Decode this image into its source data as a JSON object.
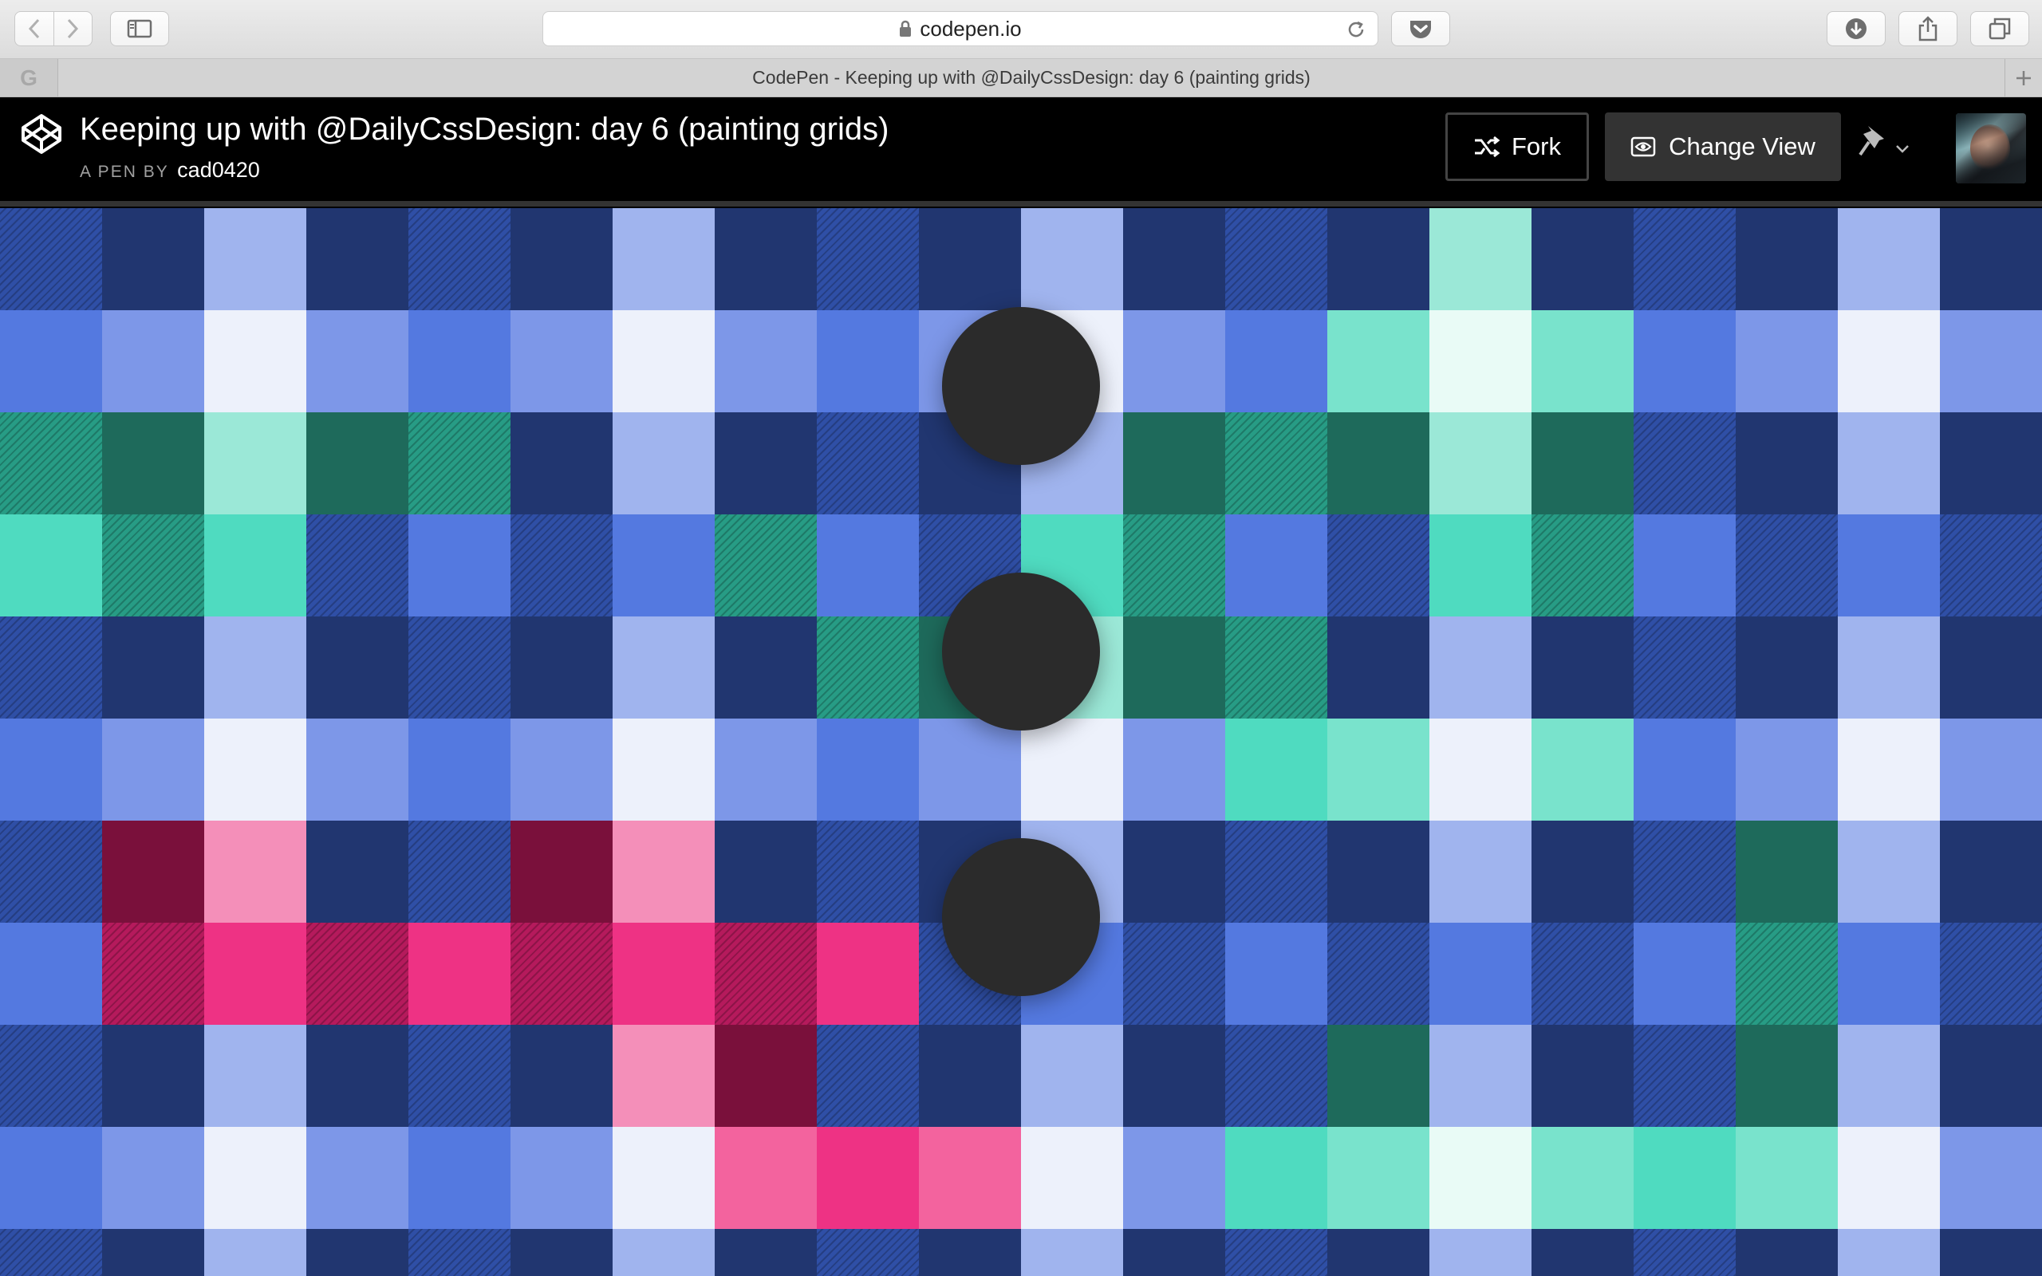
{
  "browser": {
    "url": "codepen.io",
    "tab_title": "CodePen - Keeping up with @DailyCssDesign: day 6 (painting grids)",
    "tab_favicon": "G",
    "icons": [
      "back-icon",
      "forward-icon",
      "sidebar-icon",
      "lock-icon",
      "reload-icon",
      "pocket-icon",
      "download-icon",
      "share-icon",
      "tabs-icon",
      "new-tab-icon"
    ]
  },
  "pen": {
    "title": "Keeping up with @DailyCssDesign: day 6 (painting grids)",
    "by_label": "A PEN BY",
    "author": "cad0420",
    "fork_label": "Fork",
    "change_view_label": "Change View"
  },
  "colors": {
    "navy": "#213670",
    "royal_hatch": "#2f4fa6",
    "periwinkle": "#a0b4ee",
    "blue": "#5479e0",
    "light_blue": "#7d97e8",
    "pale": "#edf1fb",
    "dark_green": "#1e6a5b",
    "green_hatch": "#279c85",
    "mint_light": "#9be8d7",
    "mint": "#4fdbc0",
    "mint_mid": "#79e3cc",
    "mint_pale": "#e9fbf6",
    "maroon": "#7a103b",
    "pink_light": "#f48fb9",
    "magenta": "#ee3284",
    "magenta_hatch": "#b51a5c",
    "pink_mid": "#f3639e",
    "dot": "#2b2b2b"
  },
  "grid": {
    "rows": [
      [
        "h:royal_hatch",
        "navy",
        "periwinkle",
        "navy",
        "h:royal_hatch",
        "navy",
        "periwinkle",
        "navy",
        "h:royal_hatch",
        "navy",
        "periwinkle",
        "navy",
        "h:royal_hatch",
        "navy",
        "mint_light",
        "navy",
        "h:royal_hatch",
        "navy",
        "periwinkle",
        "navy"
      ],
      [
        "blue",
        "light_blue",
        "pale",
        "light_blue",
        "blue",
        "light_blue",
        "pale",
        "light_blue",
        "blue",
        "light_blue",
        "pale",
        "light_blue",
        "blue",
        "mint_mid",
        "mint_pale",
        "mint_mid",
        "blue",
        "light_blue",
        "pale",
        "light_blue"
      ],
      [
        "h:green_hatch",
        "dark_green",
        "mint_light",
        "dark_green",
        "h:green_hatch",
        "navy",
        "periwinkle",
        "navy",
        "h:royal_hatch",
        "navy",
        "periwinkle",
        "dark_green",
        "h:green_hatch",
        "dark_green",
        "mint_light",
        "dark_green",
        "h:royal_hatch",
        "navy",
        "periwinkle",
        "navy"
      ],
      [
        "mint",
        "h:green_hatch",
        "mint",
        "h:royal_hatch",
        "blue",
        "h:royal_hatch",
        "blue",
        "h:green_hatch",
        "blue",
        "h:royal_hatch",
        "mint",
        "h:green_hatch",
        "blue",
        "h:royal_hatch",
        "mint",
        "h:green_hatch",
        "blue",
        "h:royal_hatch",
        "blue",
        "h:royal_hatch"
      ],
      [
        "h:royal_hatch",
        "navy",
        "periwinkle",
        "navy",
        "h:royal_hatch",
        "navy",
        "periwinkle",
        "navy",
        "h:green_hatch",
        "dark_green",
        "mint_light",
        "dark_green",
        "h:green_hatch",
        "navy",
        "periwinkle",
        "navy",
        "h:royal_hatch",
        "navy",
        "periwinkle",
        "navy"
      ],
      [
        "blue",
        "light_blue",
        "pale",
        "light_blue",
        "blue",
        "light_blue",
        "pale",
        "light_blue",
        "blue",
        "light_blue",
        "pale",
        "light_blue",
        "mint",
        "mint_mid",
        "pale",
        "mint_mid",
        "blue",
        "light_blue",
        "pale",
        "light_blue"
      ],
      [
        "h:royal_hatch",
        "maroon",
        "pink_light",
        "navy",
        "h:royal_hatch",
        "maroon",
        "pink_light",
        "navy",
        "h:royal_hatch",
        "navy",
        "periwinkle",
        "navy",
        "h:royal_hatch",
        "navy",
        "periwinkle",
        "navy",
        "h:royal_hatch",
        "dark_green",
        "periwinkle",
        "navy"
      ],
      [
        "blue",
        "h:magenta_hatch",
        "magenta",
        "h:magenta_hatch",
        "magenta",
        "h:magenta_hatch",
        "magenta",
        "h:magenta_hatch",
        "magenta",
        "h:royal_hatch",
        "blue",
        "h:royal_hatch",
        "blue",
        "h:royal_hatch",
        "blue",
        "h:royal_hatch",
        "blue",
        "h:green_hatch",
        "blue",
        "h:royal_hatch"
      ],
      [
        "h:royal_hatch",
        "navy",
        "periwinkle",
        "navy",
        "h:royal_hatch",
        "navy",
        "pink_light",
        "maroon",
        "h:royal_hatch",
        "navy",
        "periwinkle",
        "navy",
        "h:royal_hatch",
        "dark_green",
        "periwinkle",
        "navy",
        "h:royal_hatch",
        "dark_green",
        "periwinkle",
        "navy"
      ],
      [
        "blue",
        "light_blue",
        "pale",
        "light_blue",
        "blue",
        "light_blue",
        "pale",
        "pink_mid",
        "magenta",
        "pink_mid",
        "pale",
        "light_blue",
        "mint",
        "mint_mid",
        "mint_pale",
        "mint_mid",
        "mint",
        "mint_mid",
        "pale",
        "light_blue"
      ],
      [
        "h:royal_hatch",
        "navy",
        "periwinkle",
        "navy",
        "h:royal_hatch",
        "navy",
        "periwinkle",
        "navy",
        "h:royal_hatch",
        "navy",
        "periwinkle",
        "navy",
        "h:royal_hatch",
        "navy",
        "periwinkle",
        "navy",
        "h:royal_hatch",
        "navy",
        "periwinkle",
        "navy"
      ]
    ],
    "dots": 3
  }
}
